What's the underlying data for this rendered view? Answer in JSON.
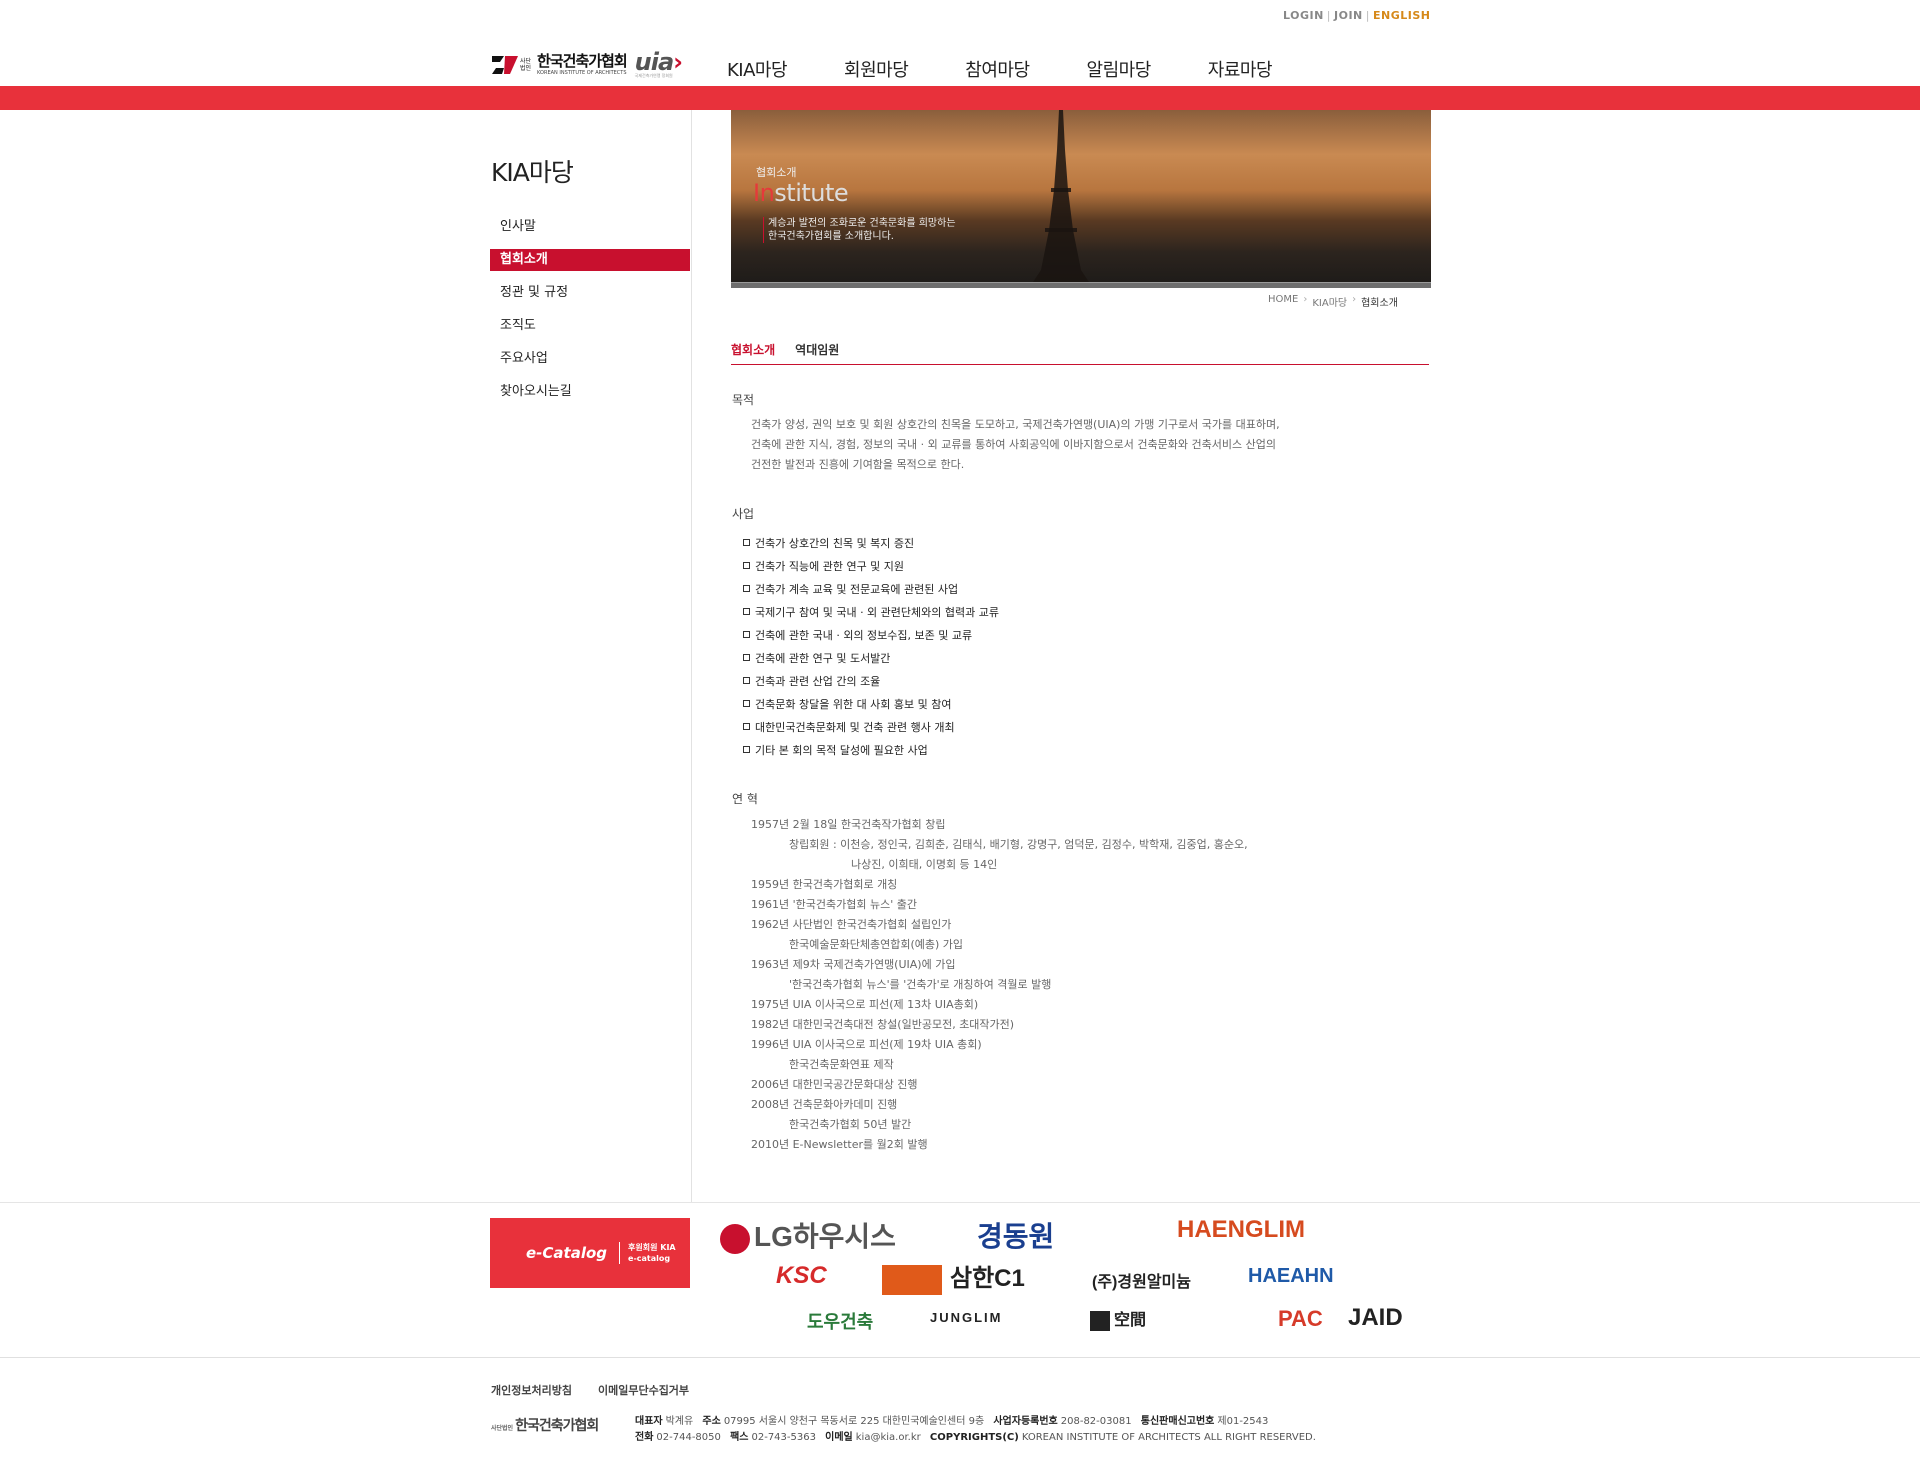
{
  "util": {
    "login": "LOGIN",
    "join": "JOIN",
    "english": "ENGLISH",
    "sep": "|"
  },
  "header": {
    "logo_prefix_1": "사단",
    "logo_prefix_2": "법인",
    "logo_text": "한국건축가협회",
    "logo_sub": "KOREAN INSTITUTE OF ARCHITECTS",
    "uia_text": "uia",
    "uia_sub": "국제건축가연맹 정회원",
    "gnb": [
      "KIA마당",
      "회원마당",
      "참여마당",
      "알림마당",
      "자료마당"
    ],
    "accent": "#e8313b"
  },
  "lnb": {
    "title": "KIA마당",
    "items": [
      {
        "label": "인사말",
        "active": false
      },
      {
        "label": "협회소개",
        "active": true
      },
      {
        "label": "정관 및 규정",
        "active": false
      },
      {
        "label": "조직도",
        "active": false
      },
      {
        "label": "주요사업",
        "active": false
      },
      {
        "label": "찾아오시는길",
        "active": false
      }
    ]
  },
  "visual": {
    "small_title": "협회소개",
    "big_title_first": "In",
    "big_title_rest": "stitute",
    "desc_line1": "계승과 발전의 조화로운 건축문화를 희망하는",
    "desc_line2": "한국건축가협회를 소개합니다."
  },
  "breadcrumb": {
    "home": "HOME",
    "level1": "KIA마당",
    "current": "협회소개",
    "arrow": "›"
  },
  "tabs": [
    "협회소개",
    "역대임원"
  ],
  "purpose": {
    "heading": "목적",
    "lines": [
      "건축가 양성, 권익 보호 및 회원 상호간의 친목을 도모하고, 국제건축가연맹(UIA)의 가맹 기구로서 국가를 대표하며,",
      "건축에 관한 지식, 경험, 정보의 국내 · 외 교류를 통하여 사회공익에 이바지함으로서 건축문화와 건축서비스 산업의",
      "건전한 발전과 진흥에 기여함을 목적으로 한다."
    ]
  },
  "business": {
    "heading": "사업",
    "items": [
      "건축가 상호간의 친목 및 복지 증진",
      "건축가 직능에 관한 연구 및 지원",
      "건축가 계속 교육 및 전문교육에 관련된 사업",
      "국제기구 참여 및 국내 · 외 관련단체와의 협력과 교류",
      "건축에 관한 국내 · 외의 정보수집, 보존 및 교류",
      "건축에 관한 연구 및 도서발간",
      "건축과 관련 산업 간의 조율",
      "건축문화 창달을 위한 대 사회 홍보 및 참여",
      "대한민국건축문화제 및 건축 관련 행사 개최",
      "기타 본 회의 목적 달성에 필요한 사업"
    ]
  },
  "history": {
    "heading": "연 혁",
    "lines": [
      {
        "text": "1957년 2월 18일 한국건축작가협회 창립",
        "indent": 0
      },
      {
        "text": "창립회원 : 이천승, 정인국, 김희춘, 김태식, 배기형, 강명구, 엄덕문, 김정수, 박학재, 김중업, 홍순오,",
        "indent": 1
      },
      {
        "text": "나상진, 이희태, 이명회 등 14인",
        "indent": 2
      },
      {
        "text": "1959년 한국건축가협회로 개칭",
        "indent": 0
      },
      {
        "text": "1961년 '한국건축가협회 뉴스' 출간",
        "indent": 0
      },
      {
        "text": "1962년 사단법인 한국건축가협회 설립인가",
        "indent": 0
      },
      {
        "text": "한국예술문화단체총연합회(예총) 가입",
        "indent": 1
      },
      {
        "text": "1963년 제9차 국제건축가연맹(UIA)에 가입",
        "indent": 0
      },
      {
        "text": "'한국건축가협회 뉴스'를 '건축가'로 개칭하여 격월로 발행",
        "indent": 1
      },
      {
        "text": "1975년 UIA 이사국으로 피선(제 13차 UIA총회)",
        "indent": 0
      },
      {
        "text": "1982년 대한민국건축대전 창설(일반공모전, 초대작가전)",
        "indent": 0
      },
      {
        "text": "1996년 UIA 이사국으로 피선(제 19차 UIA 총회)",
        "indent": 0
      },
      {
        "text": "한국건축문화연표 제작",
        "indent": 1
      },
      {
        "text": "2006년 대한민국공간문화대상 진행",
        "indent": 0
      },
      {
        "text": "2008년 건축문화아카데미 진행",
        "indent": 0
      },
      {
        "text": "한국건축가협회 50년 발간",
        "indent": 1
      },
      {
        "text": "2010년 E-Newsletter를 월2회 발행",
        "indent": 0
      }
    ]
  },
  "sponsors": {
    "ecatalog": "e-Catalog",
    "ecatalog_sub1": "후원회원 KIA",
    "ecatalog_sub2": "e-catalog",
    "logos": [
      {
        "name": "LG하우시스",
        "color": "#555555"
      },
      {
        "name": "경동원",
        "color": "#1a3f8f"
      },
      {
        "name": "HAENGLIM",
        "color": "#d64b1f"
      },
      {
        "name": "KSC",
        "color": "#d62a2a"
      },
      {
        "name": "삼한C1",
        "color": "#222222"
      },
      {
        "name": "(주)경원알미늄",
        "color": "#222222"
      },
      {
        "name": "HAEAHN",
        "color": "#1f5aa8"
      },
      {
        "name": "도우건축",
        "color": "#2a7a3a"
      },
      {
        "name": "JUNGLIM",
        "color": "#222222"
      },
      {
        "name": "空間",
        "color": "#222222"
      },
      {
        "name": "PAC",
        "color": "#d63b2a"
      },
      {
        "name": "JAID",
        "color": "#222222"
      }
    ]
  },
  "footer": {
    "links": [
      "개인정보처리방침",
      "이메일무단수집거부"
    ],
    "logo_prefix": "사단법인",
    "logo": "한국건축가협회",
    "l1_k1": "대표자",
    "l1_v1": "박계유",
    "l1_k2": "주소",
    "l1_v2": "07995 서울시 양천구 목동서로 225 대한민국예술인센터 9층",
    "l1_k3": "사업자등록번호",
    "l1_v3": "208-82-03081",
    "l1_k4": "통신판매신고번호",
    "l1_v4": "제01-2543",
    "l2_k1": "전화",
    "l2_v1": "02-744-8050",
    "l2_k2": "팩스",
    "l2_v2": "02-743-5363",
    "l2_k3": "이메일",
    "l2_v3": "kia@kia.or.kr",
    "l2_k4": "COPYRIGHTS(C)",
    "l2_v4": "KOREAN INSTITUTE OF ARCHITECTS ALL RIGHT RESERVED."
  }
}
